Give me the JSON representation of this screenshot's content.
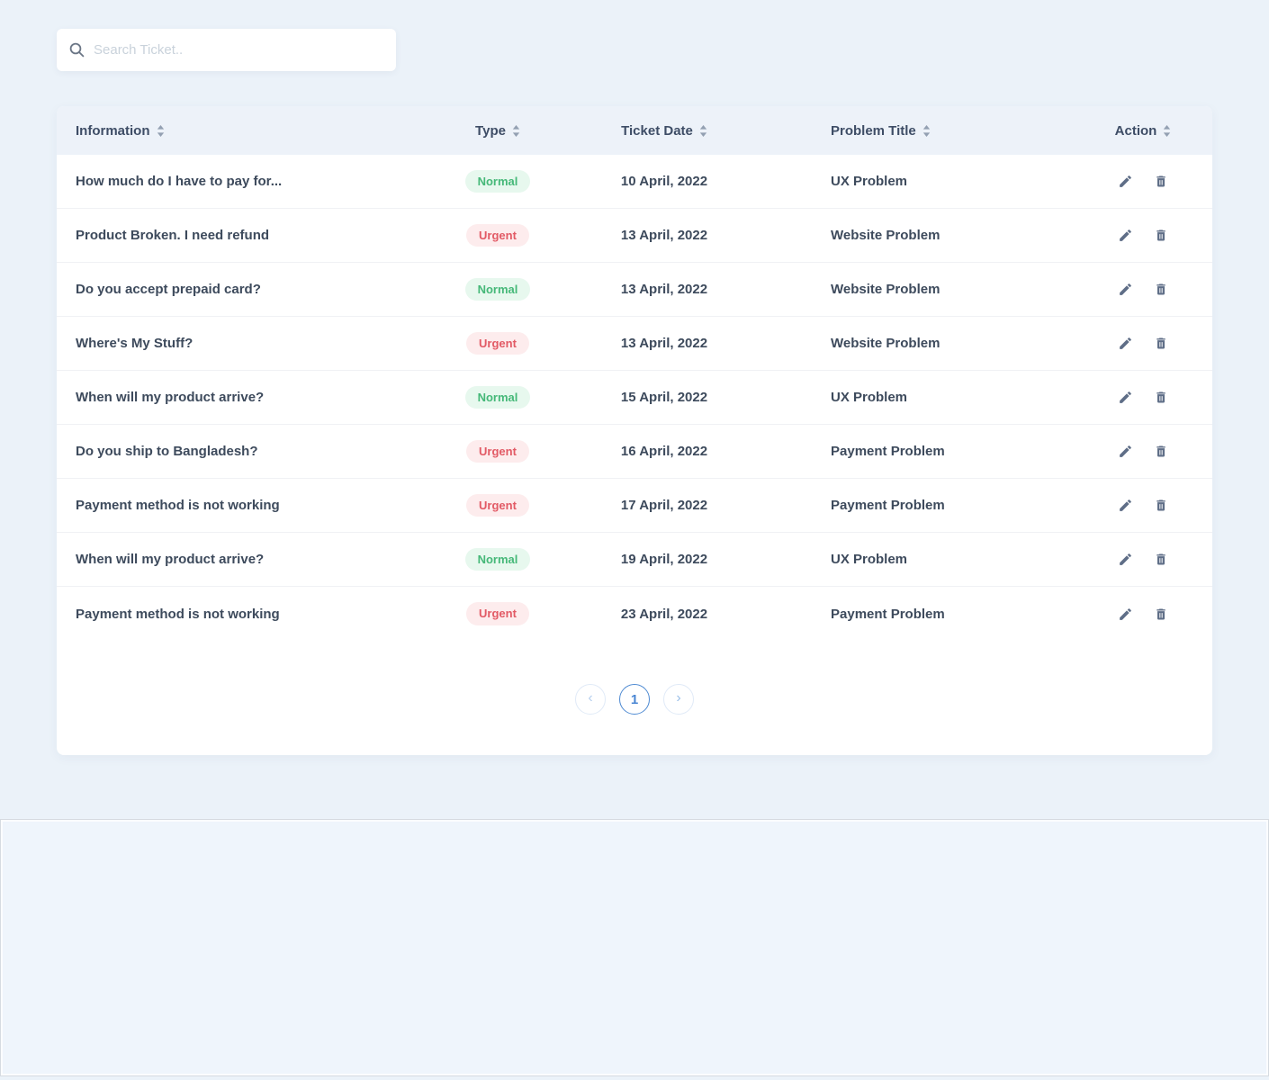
{
  "search": {
    "placeholder": "Search Ticket..",
    "icon": "search-icon"
  },
  "table": {
    "columns": [
      {
        "label": "Information",
        "sort_icon": "sort-icon"
      },
      {
        "label": "Type",
        "sort_icon": "sort-icon"
      },
      {
        "label": "Ticket Date",
        "sort_icon": "sort-icon"
      },
      {
        "label": "Problem Title",
        "sort_icon": "sort-icon"
      },
      {
        "label": "Action",
        "sort_icon": "sort-icon"
      }
    ],
    "rows": [
      {
        "information": "How much do I have to pay for...",
        "type": "Normal",
        "date": "10 April, 2022",
        "problem": "UX Problem"
      },
      {
        "information": "Product Broken. I need refund",
        "type": "Urgent",
        "date": "13 April, 2022",
        "problem": "Website Problem"
      },
      {
        "information": "Do you accept prepaid card?",
        "type": "Normal",
        "date": "13 April, 2022",
        "problem": "Website Problem"
      },
      {
        "information": "Where's My Stuff?",
        "type": "Urgent",
        "date": "13 April, 2022",
        "problem": "Website Problem"
      },
      {
        "information": "When will my product arrive?",
        "type": "Normal",
        "date": "15 April, 2022",
        "problem": "UX Problem"
      },
      {
        "information": "Do you ship to Bangladesh?",
        "type": "Urgent",
        "date": "16 April, 2022",
        "problem": "Payment Problem"
      },
      {
        "information": "Payment method is not working",
        "type": "Urgent",
        "date": "17 April, 2022",
        "problem": "Payment Problem"
      },
      {
        "information": "When will my product arrive?",
        "type": "Normal",
        "date": "19 April, 2022",
        "problem": "UX Problem"
      },
      {
        "information": "Payment method is not working",
        "type": "Urgent",
        "date": "23 April, 2022",
        "problem": "Payment Problem"
      }
    ],
    "row_actions": {
      "edit_icon": "pencil-icon",
      "delete_icon": "trash-icon"
    }
  },
  "badges": {
    "normal": {
      "label": "Normal",
      "bg": "#e7f8ee",
      "text": "#45b878"
    },
    "urgent": {
      "label": "Urgent",
      "bg": "#fdeced",
      "text": "#e25a65"
    }
  },
  "pagination": {
    "prev": "‹",
    "current": "1",
    "next": "›"
  },
  "colors": {
    "page_background": "#ebf2f9",
    "card_background": "#ffffff",
    "header_background": "#edf2f9",
    "header_text": "#3e4d66",
    "cell_text": "#3d4a5c",
    "row_separator": "#f0f1f4",
    "action_icon": "#5f6e87",
    "pagination_active": "#4a86d3",
    "pagination_inactive_border": "#e0eaf7"
  }
}
